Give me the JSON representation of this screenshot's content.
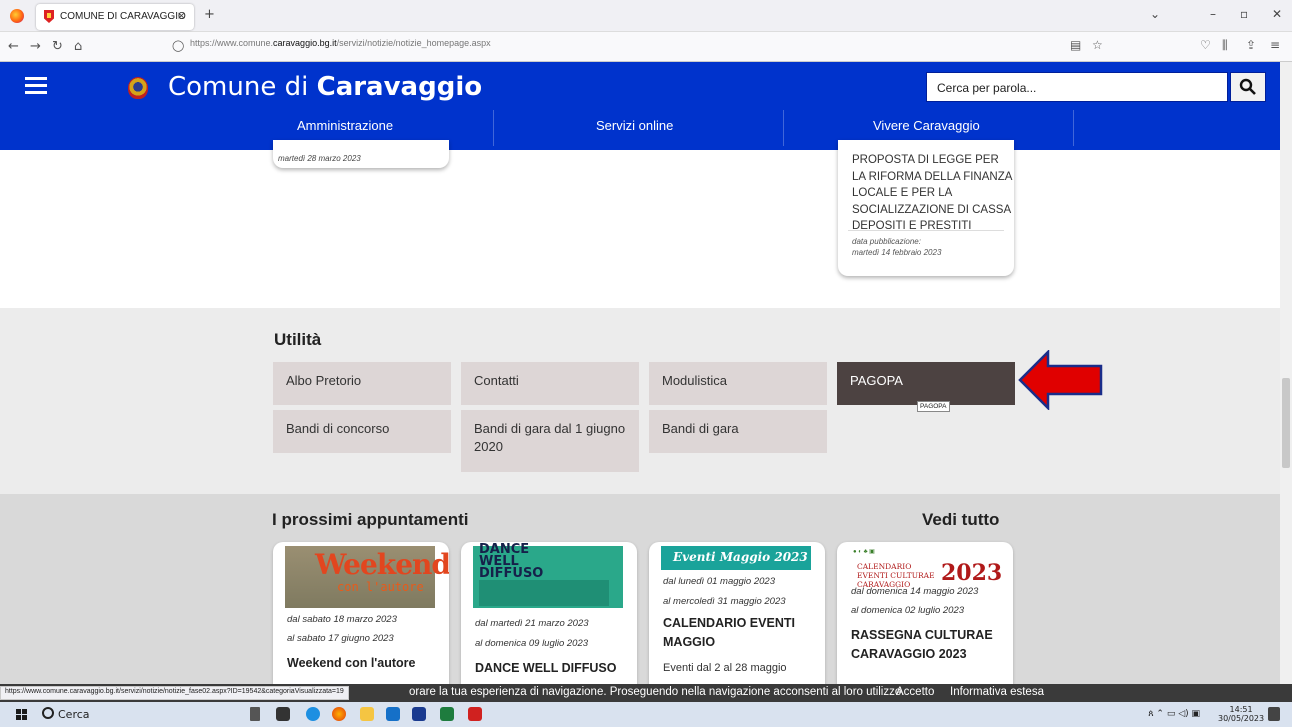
{
  "browser": {
    "tab_title": "COMUNE DI CARAVAGGIO",
    "tab_close": "×",
    "new_tab": "+",
    "url_prefix": "https://www.comune.",
    "url_domain": "caravaggio.bg.it",
    "url_path": "/servizi/notizie/notizie_homepage.aspx",
    "status_url": "https://www.comune.caravaggio.bg.it/servizi/notizie/notizie_fase02.aspx?ID=19542&categoriaVisualizzata=19"
  },
  "header": {
    "site_title_prefix": "Comune di",
    "site_title_bold": "Caravaggio",
    "search_placeholder": "Cerca per parola...",
    "nav": [
      "Amministrazione",
      "Servizi online",
      "Vivere Caravaggio"
    ]
  },
  "previous_news": {
    "card1_date": "martedì 28 marzo 2023",
    "card2_title": "PROPOSTA DI LEGGE PER LA RIFORMA DELLA FINANZA LOCALE E PER LA SOCIALIZZAZIONE DI CASSA DEPOSITI E PRESTITI",
    "card2_date_label": "data pubblicazione:",
    "card2_date": "martedì 14 febbraio 2023"
  },
  "utilita": {
    "title": "Utilità",
    "buttons": [
      "Albo Pretorio",
      "Contatti",
      "Modulistica",
      "PAGOPA",
      "Bandi di concorso",
      "Bandi di gara dal 1 giugno 2020",
      "Bandi di gara"
    ],
    "tooltip": "PAGOPA"
  },
  "events": {
    "title": "I prossimi appuntamenti",
    "see_all": "Vedi tutto",
    "items": [
      {
        "img_text": "Weekend",
        "img_sub": "con l'autore",
        "d1": "dal sabato 18 marzo 2023",
        "d2": "al sabato 17 giugno 2023",
        "title": "Weekend con l'autore",
        "excerpt": ""
      },
      {
        "img_text": "DANCE WELL DIFFUSO",
        "img_sub": "",
        "d1": "dal martedì 21 marzo 2023",
        "d2": "al domenica 09 luglio 2023",
        "title": "DANCE WELL DIFFUSO",
        "excerpt": ""
      },
      {
        "img_text": "Eventi Maggio 2023",
        "img_sub": "",
        "d1": "dal lunedì 01 maggio 2023",
        "d2": "al mercoledì 31 maggio 2023",
        "title": "CALENDARIO EVENTI MAGGIO",
        "excerpt": "Eventi dal 2 al 28 maggio"
      },
      {
        "img_text": "CALENDARIO EVENTI CULTURAE CARAVAGGIO",
        "img_sub": "2023",
        "d1": "dal domenica 14 maggio 2023",
        "d2": "al domenica 02 luglio 2023",
        "title": "RASSEGNA CULTURAE CARAVAGGIO 2023",
        "excerpt": ""
      }
    ]
  },
  "cookie": {
    "message": "orare la tua esperienza di navigazione. Proseguendo nella navigazione acconsenti al loro utilizzo.",
    "accept": "Accetto",
    "info": "Informativa estesa"
  },
  "taskbar": {
    "search_label": "Cerca",
    "time": "14:51",
    "date": "30/05/2023"
  },
  "colors": {
    "brand": "#0033cc",
    "pagopa_active": "#4c4241",
    "arrow": "#e00000"
  }
}
